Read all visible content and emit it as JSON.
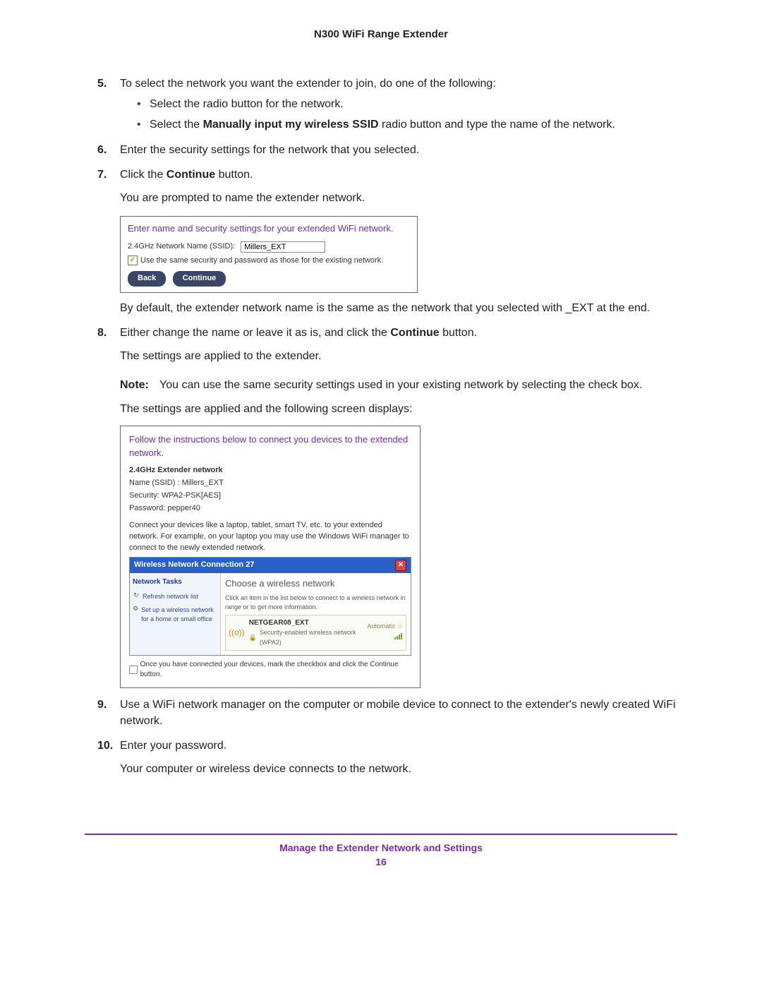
{
  "header": {
    "title": "N300 WiFi Range Extender"
  },
  "steps": {
    "s5": {
      "num": "5.",
      "text": "To select the network you want the extender to join, do one of the following:",
      "bullets": [
        "Select the radio button for the network.",
        {
          "pre": "Select the ",
          "bold": "Manually input my wireless SSID",
          "post": " radio button and type the name of the network."
        }
      ]
    },
    "s6": {
      "num": "6.",
      "text": "Enter the security settings for the network that you selected."
    },
    "s7": {
      "num": "7.",
      "pre": "Click the ",
      "bold": "Continue",
      "post": " button.",
      "para": "You are prompted to name the extender network.",
      "after": "By default, the extender network name is the same as the network that you selected with _EXT at the end."
    },
    "s8": {
      "num": "8.",
      "pre": "Either change the name or leave it as is, and click the ",
      "bold": "Continue",
      "post": " button.",
      "para1": "The settings are applied to the extender.",
      "note_label": "Note:",
      "note_text": "You can use the same security settings used in your existing network by selecting the check box.",
      "para2": "The settings are applied and the following screen displays:"
    },
    "s9": {
      "num": "9.",
      "text": "Use a WiFi network manager on the computer or mobile device to connect to the extender's newly created WiFi network."
    },
    "s10": {
      "num": "10.",
      "text": "Enter your password.",
      "para": "Your computer or wireless device connects to the network."
    }
  },
  "shot1": {
    "title": "Enter name and security settings for your extended WiFi network.",
    "ssid_label": "2.4GHz Network Name (SSID):",
    "ssid_value": "Millers_EXT",
    "chk_label": "Use the same security and password as those for the existing network.",
    "back": "Back",
    "continue": "Continue"
  },
  "shot2": {
    "title": "Follow the instructions below to connect you devices to the extended network.",
    "section": "2.4GHz Extender network",
    "ssid": "Name (SSID) : Millers_EXT",
    "sec": "Security: WPA2-PSK[AES]",
    "pwd": "Password: pepper40",
    "desc": "Connect your devices like a laptop, tablet, smart TV, etc. to your extended network. For example, on your laptop you may use the Windows WiFi manager to connect to the newly extended network.",
    "xp_title": "Wireless Network Connection 27",
    "xp_tasks_title": "Network Tasks",
    "xp_task1": "Refresh network list",
    "xp_task2": "Set up a wireless network for a home or small office",
    "xp_main_title": "Choose a wireless network",
    "xp_main_sub": "Click an item in the list below to connect to a wireless network in range or to get more information.",
    "xp_net_name": "NETGEAR08_EXT",
    "xp_net_auto": "Automatic",
    "xp_net_sec": "Security-enabled wireless network (WPA2)",
    "final_chk": "Once you have connected your devices, mark the checkbox and click the Continue button."
  },
  "footer": {
    "text": "Manage the Extender Network and Settings",
    "page": "16"
  }
}
